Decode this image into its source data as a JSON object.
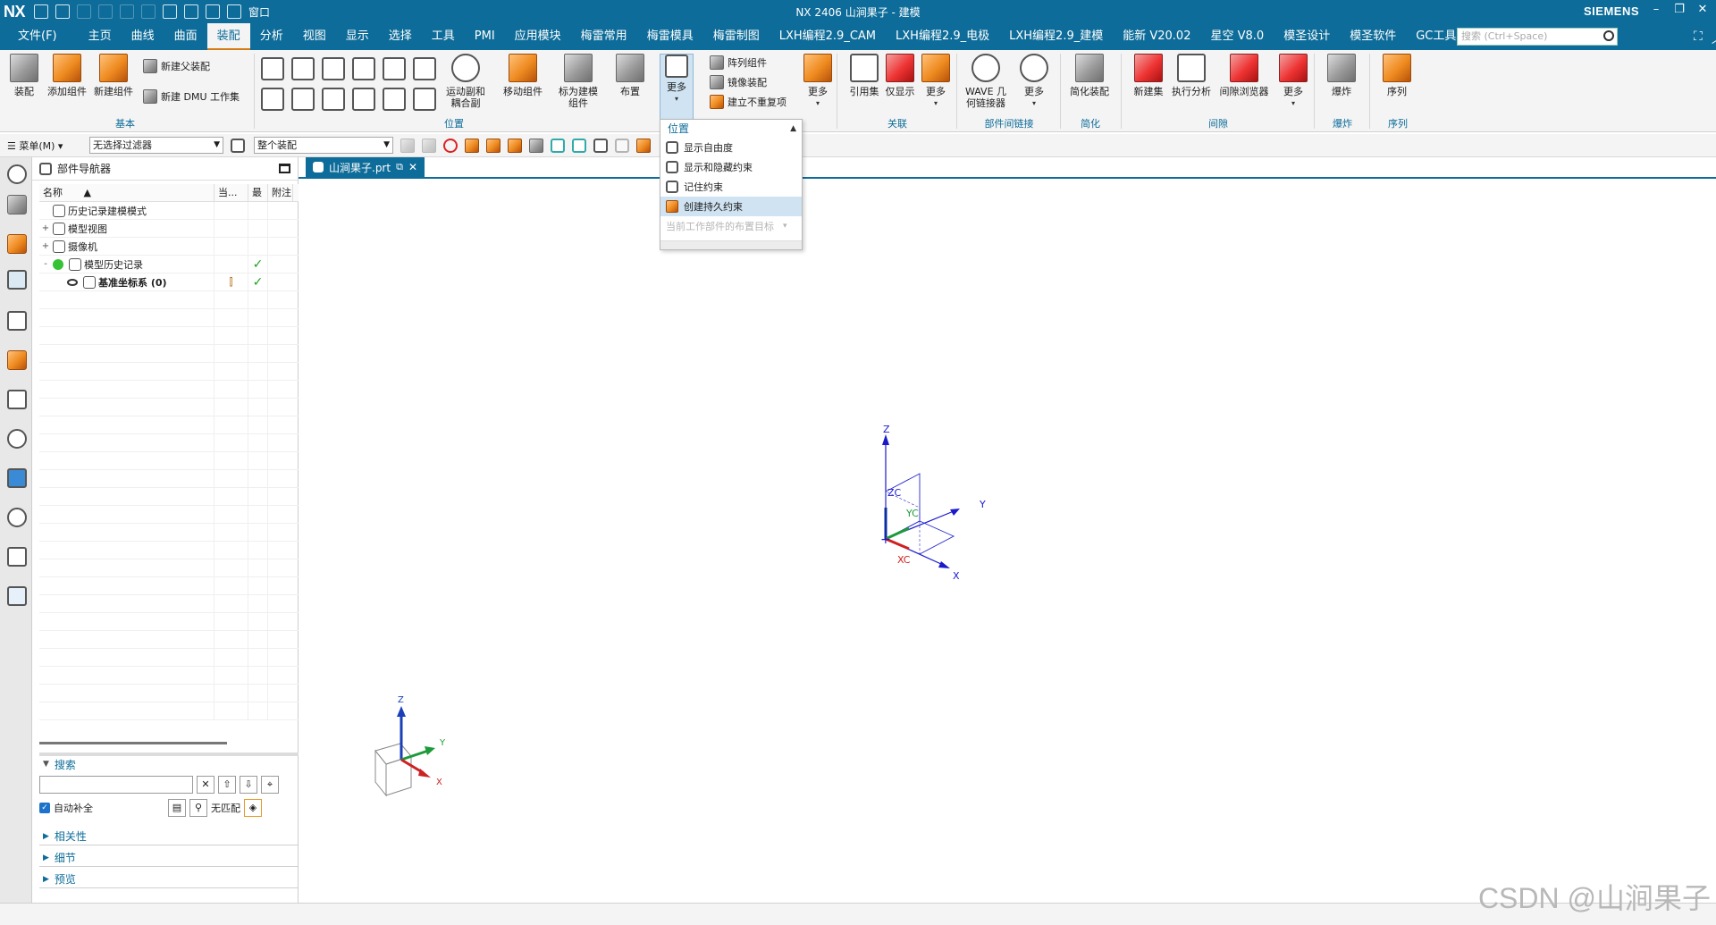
{
  "titlebar": {
    "logo": "NX",
    "title": "NX 2406 山涧果子 - 建模",
    "brand": "SIEMENS",
    "window_label": "窗口",
    "accent": "#0d6c99"
  },
  "menubar": {
    "items": [
      "文件(F)",
      "主页",
      "曲线",
      "曲面",
      "装配",
      "分析",
      "视图",
      "显示",
      "选择",
      "工具",
      "PMI",
      "应用模块",
      "梅雷常用",
      "梅雷模具",
      "梅雷制图",
      "LXH编程2.9_CAM",
      "LXH编程2.9_电极",
      "LXH编程2.9_建模",
      "能新 V20.02",
      "星空 V8.0",
      "模圣设计",
      "模圣软件",
      "GC工具箱"
    ],
    "active": "装配",
    "search_placeholder": "搜索 (Ctrl+Space)"
  },
  "ribbon": {
    "groups": [
      {
        "label": "基本",
        "buttons": [
          "装配",
          "添加组件",
          "新建组件"
        ],
        "small": [
          "新建父装配",
          "新建 DMU 工作集"
        ]
      },
      {
        "label": "位置",
        "buttons": [
          "运动副和耦合副",
          "移动组件",
          "标为建模组件",
          "布置"
        ]
      },
      {
        "label": "",
        "buttons": [
          "更多"
        ],
        "small": [
          "阵列组件",
          "镜像装配",
          "建立不重复项"
        ]
      },
      {
        "label": "",
        "buttons": [
          "更多"
        ]
      },
      {
        "label": "关联",
        "buttons": [
          "引用集",
          "仅显示",
          "更多"
        ]
      },
      {
        "label": "部件间链接",
        "buttons": [
          "WAVE 几何链接器",
          "更多"
        ]
      },
      {
        "label": "简化",
        "buttons": [
          "简化装配"
        ]
      },
      {
        "label": "间隙",
        "buttons": [
          "新建集",
          "执行分析",
          "间隙浏览器",
          "更多"
        ]
      },
      {
        "label": "爆炸",
        "buttons": [
          "爆炸"
        ]
      },
      {
        "label": "序列",
        "buttons": [
          "序列"
        ]
      }
    ]
  },
  "toolbar2": {
    "menu_label": "菜单(M)",
    "filter_value": "无选择过滤器",
    "scope_value": "整个装配"
  },
  "navigator": {
    "title": "部件导航器",
    "columns": [
      "名称",
      "当...",
      "最",
      "附注"
    ],
    "rows": [
      {
        "indent": 1,
        "expander": "",
        "name": "历史记录建模模式",
        "icon": "clock-icon",
        "check": "",
        "c1": ""
      },
      {
        "indent": 1,
        "expander": "+",
        "name": "模型视图",
        "icon": "model-view-icon",
        "check": "",
        "c1": ""
      },
      {
        "indent": 1,
        "expander": "+",
        "name": "摄像机",
        "icon": "camera-icon",
        "check": "",
        "c1": ""
      },
      {
        "indent": 1,
        "expander": "-",
        "name": "模型历史记录",
        "icon": "history-folder-icon",
        "check": "✓",
        "c1": ""
      },
      {
        "indent": 2,
        "expander": "",
        "name": "基准坐标系 (0)",
        "icon": "datum-csys-icon",
        "check": "✓",
        "c1": "⫿"
      }
    ]
  },
  "search": {
    "title": "搜索",
    "autocomplete_label": "自动补全",
    "match_label": "无匹配",
    "sections": [
      "相关性",
      "细节",
      "预览"
    ]
  },
  "viewport": {
    "tab_label": "山涧果子.prt",
    "axis_labels": {
      "z": "Z",
      "y": "Y",
      "x": "X",
      "zc": "ZC",
      "yc": "YC",
      "xc": "XC"
    }
  },
  "dropdown": {
    "header": "位置",
    "items": [
      "显示自由度",
      "显示和隐藏约束",
      "记住约束",
      "创建持久约束",
      "当前工作部件的布置目标"
    ],
    "highlighted_index": 3
  },
  "watermark": "CSDN @山涧果子"
}
